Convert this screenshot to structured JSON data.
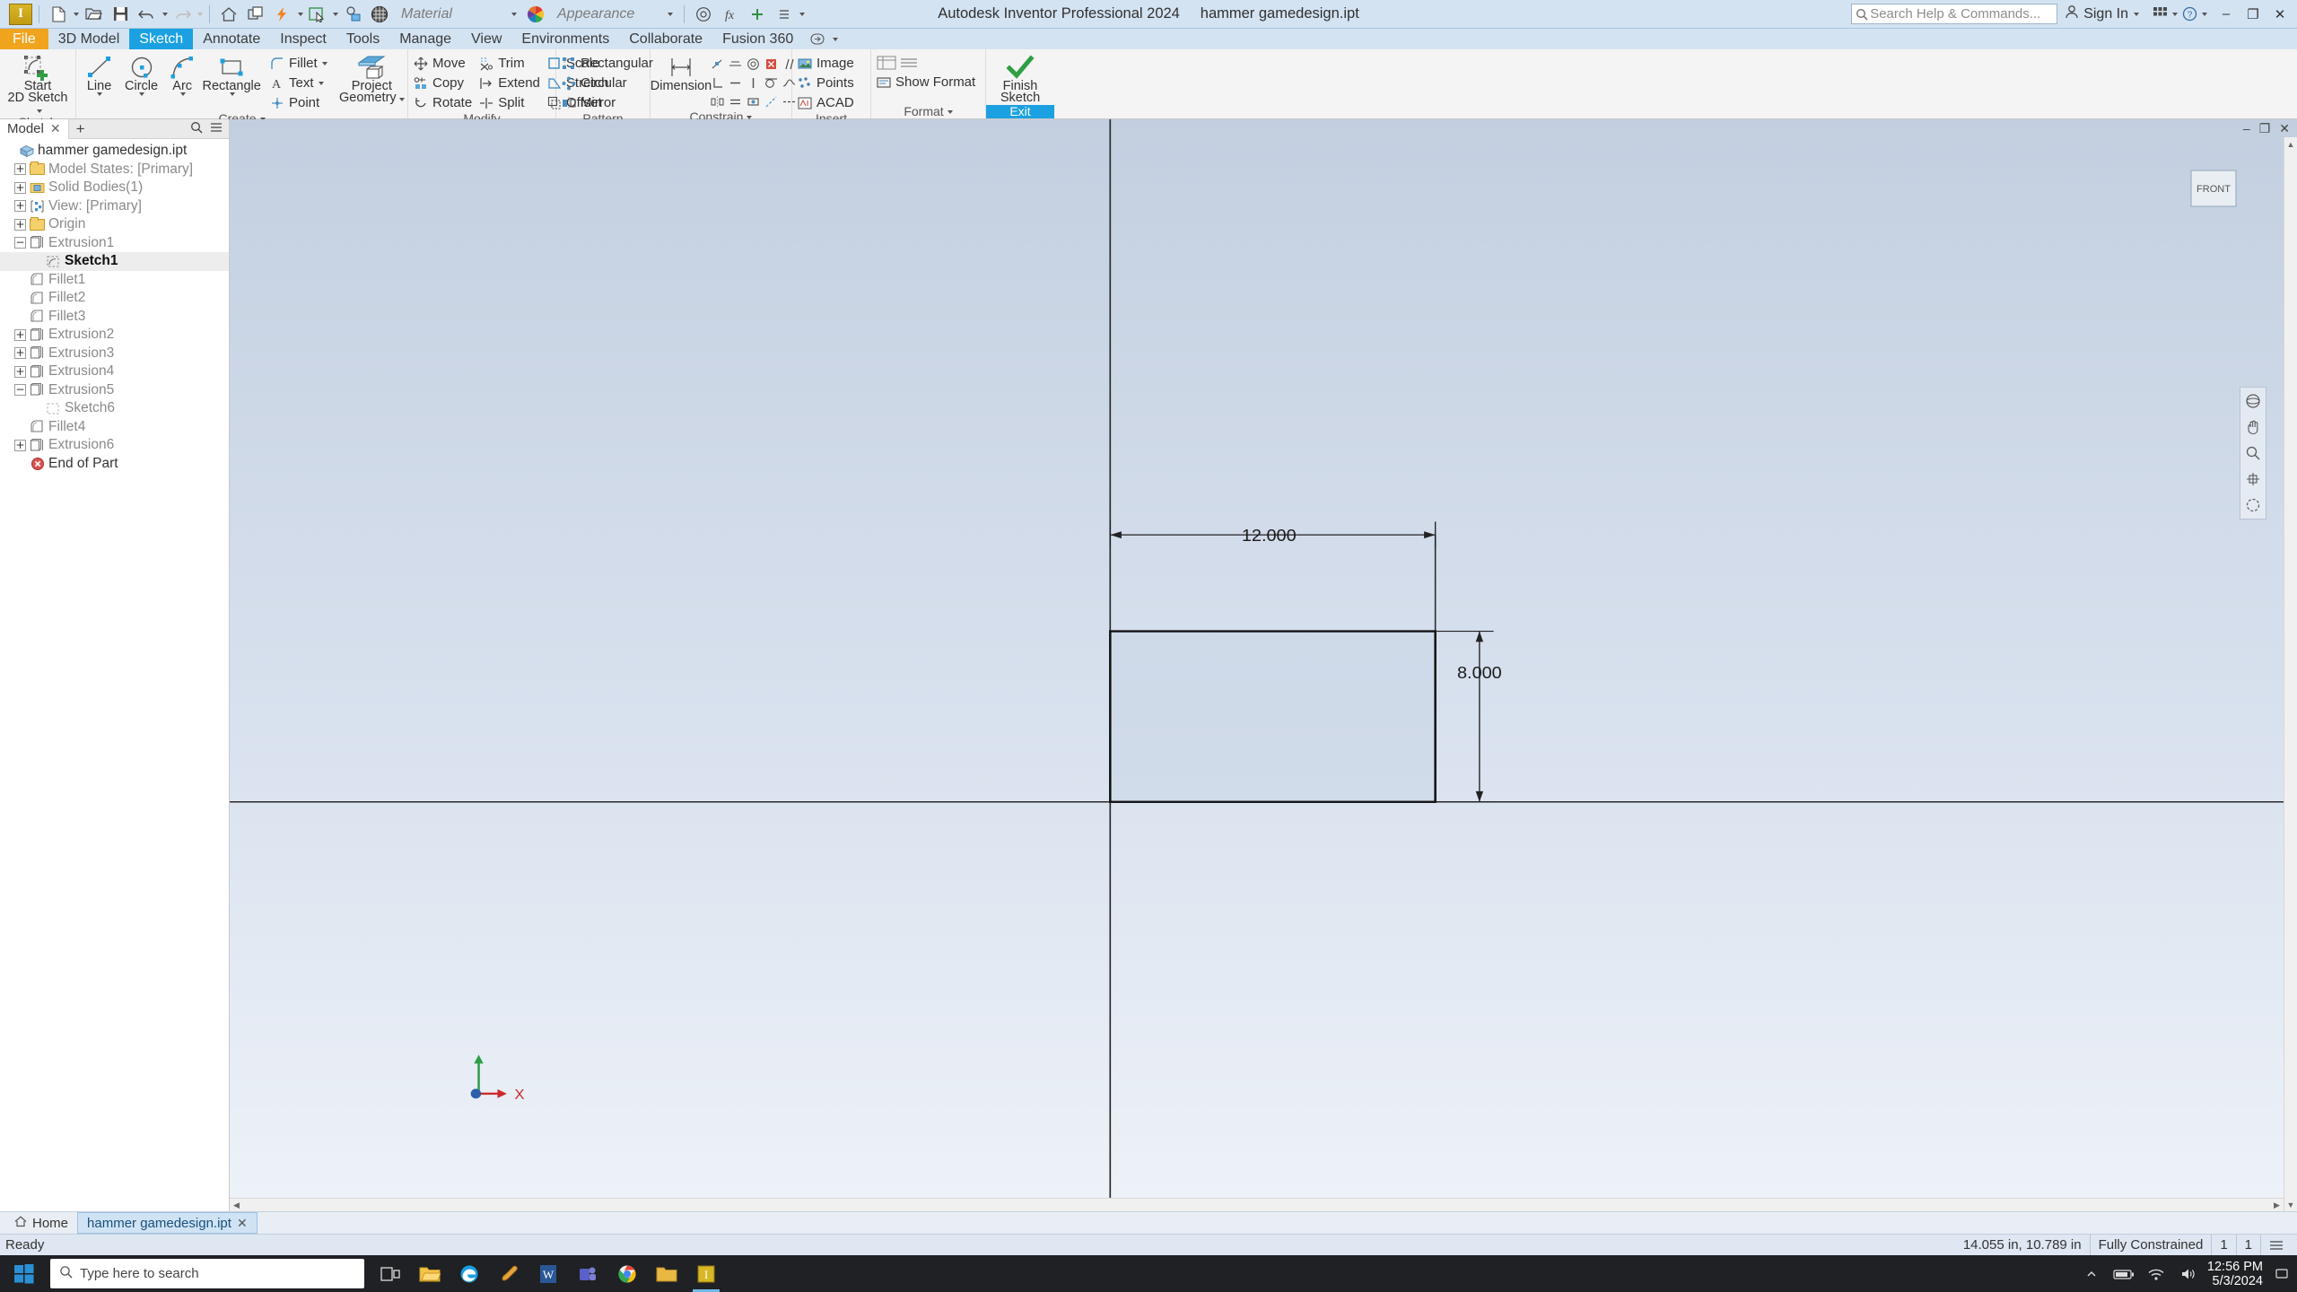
{
  "titlebar": {
    "app_title": "Autodesk Inventor Professional 2024",
    "document_title": "hammer gamedesign.ipt",
    "material_placeholder": "Material",
    "appearance_label": "Appearance",
    "search_placeholder": "Search Help & Commands...",
    "signin_label": "Sign In",
    "logo_letter": "I",
    "minimize": "–",
    "maximize": "❐",
    "close": "✕"
  },
  "tabs": [
    {
      "label": "File",
      "kind": "file"
    },
    {
      "label": "3D Model",
      "kind": "normal"
    },
    {
      "label": "Sketch",
      "kind": "active"
    },
    {
      "label": "Annotate",
      "kind": "normal"
    },
    {
      "label": "Inspect",
      "kind": "normal"
    },
    {
      "label": "Tools",
      "kind": "normal"
    },
    {
      "label": "Manage",
      "kind": "normal"
    },
    {
      "label": "View",
      "kind": "normal"
    },
    {
      "label": "Environments",
      "kind": "normal"
    },
    {
      "label": "Collaborate",
      "kind": "normal"
    },
    {
      "label": "Fusion 360",
      "kind": "normal"
    }
  ],
  "ribbon": {
    "sketch_panel": {
      "label": "Sketch",
      "start_line1": "Start",
      "start_line2": "2D Sketch"
    },
    "create_panel": {
      "label": "Create",
      "line": "Line",
      "circle": "Circle",
      "arc": "Arc",
      "rectangle": "Rectangle",
      "fillet": "Fillet",
      "text": "Text",
      "point": "Point",
      "project_geometry_l1": "Project",
      "project_geometry_l2": "Geometry"
    },
    "modify_panel": {
      "label": "Modify",
      "move": "Move",
      "copy": "Copy",
      "rotate": "Rotate",
      "trim": "Trim",
      "extend": "Extend",
      "split": "Split",
      "scale": "Scale",
      "stretch": "Stretch",
      "offset": "Offset"
    },
    "pattern_panel": {
      "label": "Pattern",
      "rectangular": "Rectangular",
      "circular": "Circular",
      "mirror": "Mirror"
    },
    "constrain_panel": {
      "label": "Constrain",
      "dimension": "Dimension"
    },
    "insert_panel": {
      "label": "Insert",
      "image": "Image",
      "points": "Points",
      "acad": "ACAD"
    },
    "format_panel": {
      "label": "Format",
      "show_format": "Show Format"
    },
    "exit_panel": {
      "label": "Exit",
      "finish_l1": "Finish",
      "finish_l2": "Sketch"
    }
  },
  "browser": {
    "tab_label": "Model",
    "tab_close": "✕",
    "add_tab": "+",
    "tree": [
      {
        "label": "hammer gamedesign.ipt",
        "indent": 0,
        "expander": "none",
        "icon": "part-icon",
        "state": "root"
      },
      {
        "label": "Model States: [Primary]",
        "indent": 1,
        "expander": "+",
        "icon": "folder-icon",
        "state": "normal"
      },
      {
        "label": "Solid Bodies(1)",
        "indent": 1,
        "expander": "+",
        "icon": "solid-bodies-icon",
        "state": "normal"
      },
      {
        "label": "View: [Primary]",
        "indent": 1,
        "expander": "+",
        "icon": "view-icon",
        "state": "normal"
      },
      {
        "label": "Origin",
        "indent": 1,
        "expander": "+",
        "icon": "folder-icon",
        "state": "normal"
      },
      {
        "label": "Extrusion1",
        "indent": 1,
        "expander": "−",
        "icon": "extrusion-icon",
        "state": "normal"
      },
      {
        "label": "Sketch1",
        "indent": 2,
        "expander": "none",
        "icon": "sketch-icon",
        "state": "active"
      },
      {
        "label": "Fillet1",
        "indent": 1,
        "expander": "none",
        "icon": "fillet-icon",
        "state": "normal"
      },
      {
        "label": "Fillet2",
        "indent": 1,
        "expander": "none",
        "icon": "fillet-icon",
        "state": "normal"
      },
      {
        "label": "Fillet3",
        "indent": 1,
        "expander": "none",
        "icon": "fillet-icon",
        "state": "normal"
      },
      {
        "label": "Extrusion2",
        "indent": 1,
        "expander": "+",
        "icon": "extrusion-icon",
        "state": "normal"
      },
      {
        "label": "Extrusion3",
        "indent": 1,
        "expander": "+",
        "icon": "extrusion-icon",
        "state": "normal"
      },
      {
        "label": "Extrusion4",
        "indent": 1,
        "expander": "+",
        "icon": "extrusion-icon",
        "state": "normal"
      },
      {
        "label": "Extrusion5",
        "indent": 1,
        "expander": "−",
        "icon": "extrusion-icon",
        "state": "normal"
      },
      {
        "label": "Sketch6",
        "indent": 2,
        "expander": "none",
        "icon": "sketch-icon",
        "state": "normal"
      },
      {
        "label": "Fillet4",
        "indent": 1,
        "expander": "none",
        "icon": "fillet-icon",
        "state": "normal"
      },
      {
        "label": "Extrusion6",
        "indent": 1,
        "expander": "+",
        "icon": "extrusion-icon",
        "state": "normal"
      },
      {
        "label": "End of Part",
        "indent": 1,
        "expander": "none",
        "icon": "end-of-part-icon",
        "state": "eop"
      }
    ]
  },
  "canvas": {
    "viewcube_face": "FRONT",
    "dim_horizontal": "12.000",
    "dim_vertical": "8.000",
    "axis_x_label": "X",
    "win_minimize": "–",
    "win_restore": "❐",
    "win_close": "✕"
  },
  "doctabs": {
    "home": "Home",
    "document": "hammer gamedesign.ipt",
    "close": "✕"
  },
  "status": {
    "ready": "Ready",
    "coordinates": "14.055 in, 10.789 in",
    "constraint_state": "Fully Constrained",
    "count_a": "1",
    "count_b": "1"
  },
  "taskbar": {
    "search_placeholder": "Type here to search",
    "time": "12:56 PM",
    "date": "5/3/2024"
  },
  "colors": {
    "accent_blue": "#1ba1e2",
    "file_orange": "#f0a41e",
    "titlebar_bg": "#d4e3f2",
    "sketch_line": "#1c1c1c"
  }
}
